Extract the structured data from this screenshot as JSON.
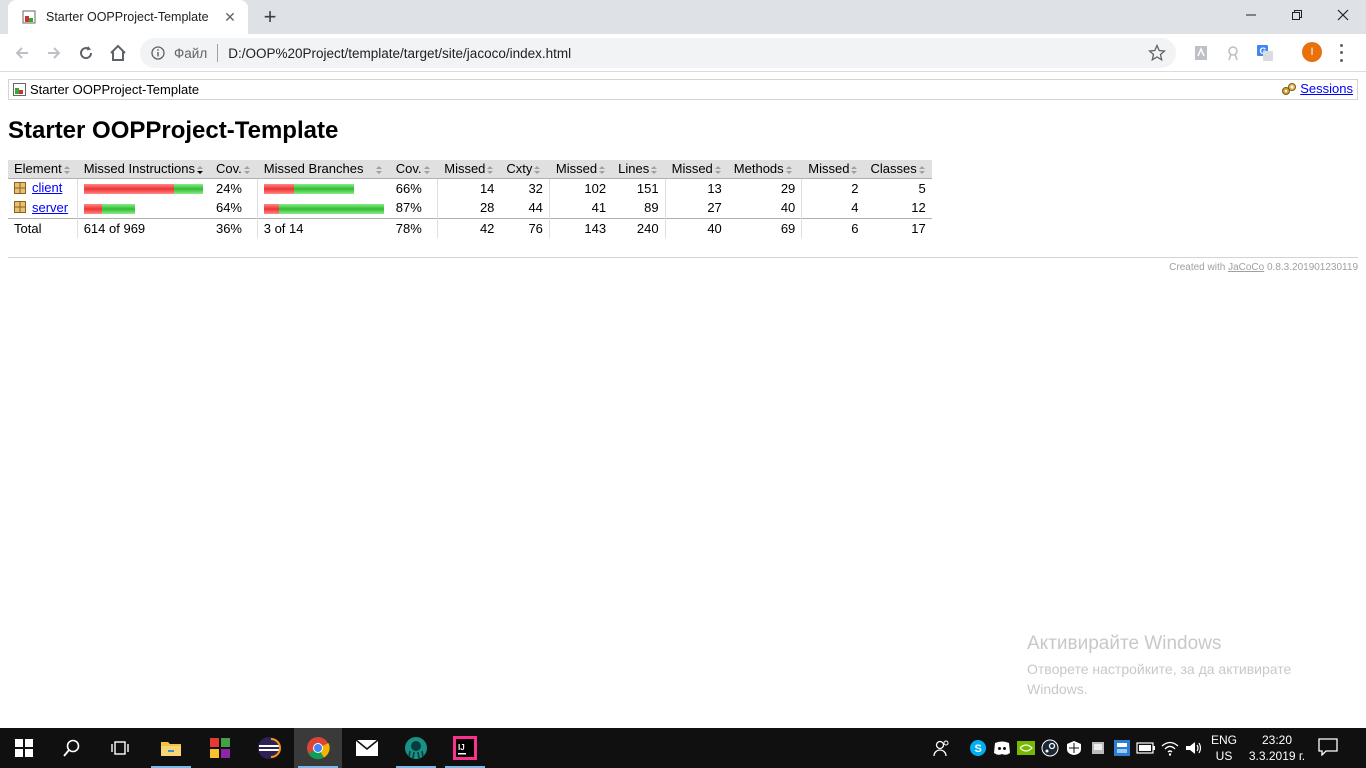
{
  "browser": {
    "tab_title": "Starter OOPProject-Template",
    "omnibox_label": "Файл",
    "url": "D:/OOP%20Project/template/target/site/jacoco/index.html",
    "profile_initial": "I"
  },
  "breadcrumb": {
    "title": "Starter OOPProject-Template",
    "sessions_label": "Sessions"
  },
  "page": {
    "heading": "Starter OOPProject-Template"
  },
  "table": {
    "headers": [
      "Element",
      "Missed Instructions",
      "Cov.",
      "Missed Branches",
      "Cov.",
      "Missed",
      "Cxty",
      "Missed",
      "Lines",
      "Missed",
      "Methods",
      "Missed",
      "Classes"
    ],
    "rows": [
      {
        "name": "client",
        "instr_cov": "24%",
        "branch_cov": "66%",
        "missed_cxty": "14",
        "cxty": "32",
        "missed_lines": "102",
        "lines": "151",
        "missed_methods": "13",
        "methods": "29",
        "missed_classes": "2",
        "classes": "5",
        "instr_bar": {
          "missed": 90,
          "covered": 29
        },
        "branch_bar": {
          "missed": 30,
          "covered": 60
        }
      },
      {
        "name": "server",
        "instr_cov": "64%",
        "branch_cov": "87%",
        "missed_cxty": "28",
        "cxty": "44",
        "missed_lines": "41",
        "lines": "89",
        "missed_methods": "27",
        "methods": "40",
        "missed_classes": "4",
        "classes": "12",
        "instr_bar": {
          "missed": 18,
          "covered": 33
        },
        "branch_bar": {
          "missed": 15,
          "covered": 105
        }
      }
    ],
    "total": {
      "label": "Total",
      "instructions": "614 of 969",
      "instr_cov": "36%",
      "branches": "3 of 14",
      "branch_cov": "78%",
      "missed_cxty": "42",
      "cxty": "76",
      "missed_lines": "143",
      "lines": "240",
      "missed_methods": "40",
      "methods": "69",
      "missed_classes": "6",
      "classes": "17"
    }
  },
  "footer": {
    "prefix": "Created with",
    "link": "JaCoCo",
    "version": "0.8.3.201901230119"
  },
  "watermark": {
    "title": "Активирайте Windows",
    "subtitle": "Отворете настройките, за да активирате Windows."
  },
  "taskbar": {
    "lang_top": "ENG",
    "lang_bottom": "US",
    "time": "23:20",
    "date": "3.3.2019 г."
  },
  "colors": {
    "bar_red": "#ee3333",
    "bar_green": "#33bb33",
    "profile": "#e8710a",
    "taskbar": "#101010"
  }
}
